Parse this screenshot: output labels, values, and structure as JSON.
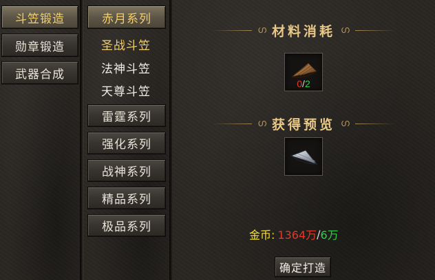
{
  "tabs": [
    {
      "label": "斗笠锻造",
      "active": true
    },
    {
      "label": "勋章锻造",
      "active": false
    },
    {
      "label": "武器合成",
      "active": false
    }
  ],
  "series": {
    "expanded_label": "赤月系列",
    "sub_items": [
      {
        "label": "圣战斗笠",
        "active": true
      },
      {
        "label": "法神斗笠",
        "active": false
      },
      {
        "label": "天尊斗笠",
        "active": false
      }
    ],
    "collapsed": [
      "雷霆系列",
      "强化系列",
      "战神系列",
      "精品系列",
      "极品系列"
    ]
  },
  "materials": {
    "title": "材料消耗",
    "owned": "0",
    "separator": "/",
    "required": "2",
    "icon": "brown-straw-hat-icon"
  },
  "preview": {
    "title": "获得预览",
    "icon": "silver-straw-hat-icon"
  },
  "gold": {
    "label": "金币:",
    "owned": "1364万",
    "separator": "/",
    "required": "6万"
  },
  "confirm_label": "确定打造",
  "colors": {
    "gold_text": "#f2cf6a",
    "insufficient": "#e23a2a",
    "sufficient": "#2fd04a",
    "label_yellow": "#f5e02a"
  }
}
